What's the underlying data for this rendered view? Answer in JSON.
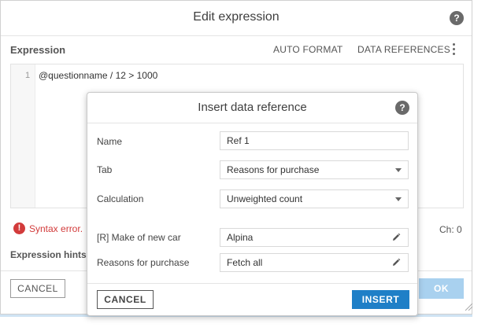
{
  "outer": {
    "title": "Edit expression",
    "help_icon": "?",
    "expression_label": "Expression",
    "auto_format": "AUTO FORMAT",
    "data_references": "DATA REFERENCES",
    "line_number": "1",
    "code": "@questionname / 12 > 1000",
    "error_icon": "!",
    "syntax_error": "Syntax error.",
    "ch_label": "Ch:   0",
    "hints_label": "Expression hints",
    "cancel": "CANCEL",
    "ok": "OK"
  },
  "inner": {
    "title": "Insert data reference",
    "help_icon": "?",
    "fields": [
      {
        "label": "Name",
        "value": "Ref 1",
        "kind": "text"
      },
      {
        "label": "Tab",
        "value": "Reasons for purchase",
        "kind": "select"
      },
      {
        "label": "Calculation",
        "value": "Unweighted count",
        "kind": "select"
      },
      {
        "label": "[R] Make of new car",
        "value": "Alpina",
        "kind": "edit"
      },
      {
        "label": "Reasons for purchase",
        "value": "Fetch all",
        "kind": "edit"
      }
    ],
    "cancel": "CANCEL",
    "insert": "INSERT"
  },
  "colors": {
    "primary": "#1f7fc7",
    "ok_disabled": "#a9d1ef",
    "error": "#d23b3b"
  }
}
